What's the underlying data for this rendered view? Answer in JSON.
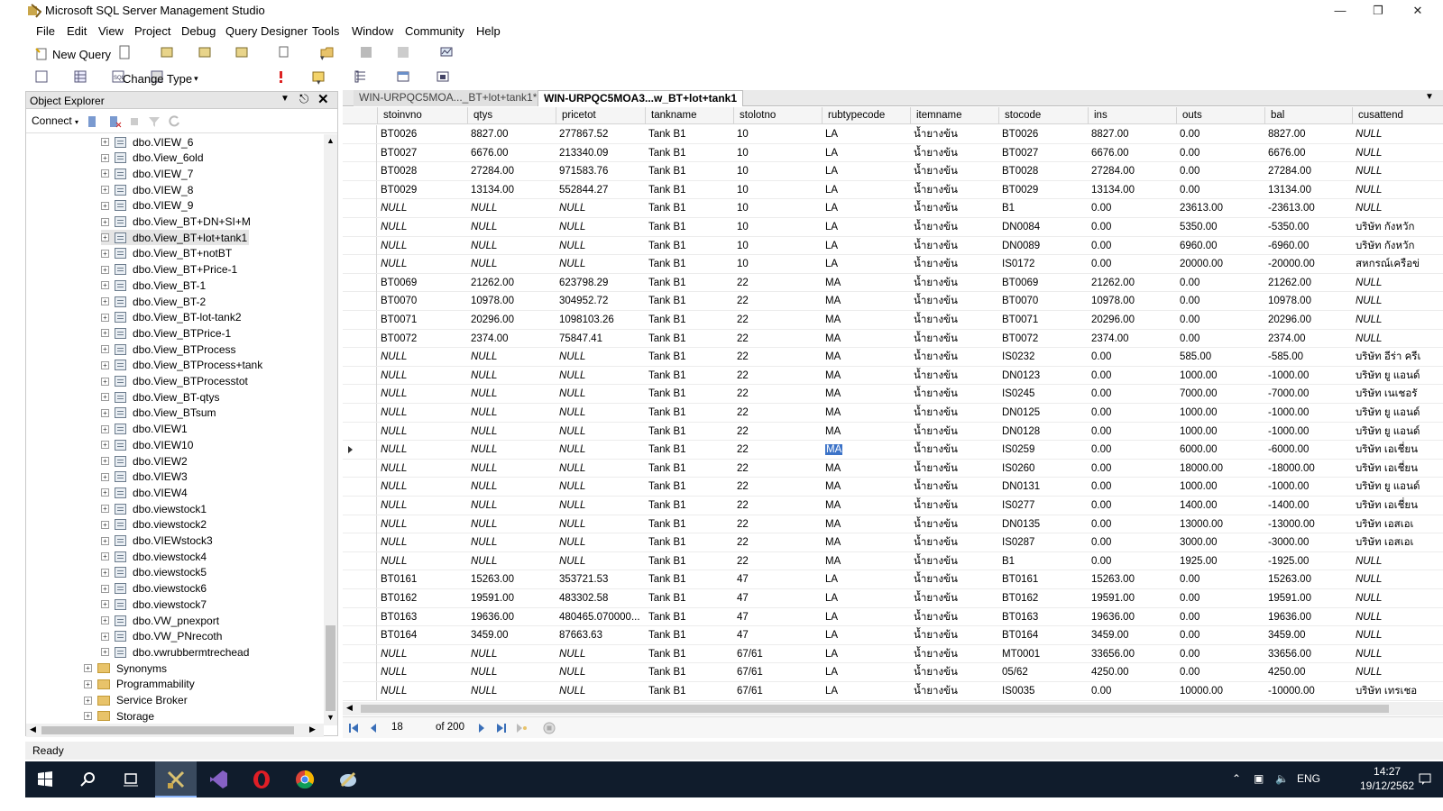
{
  "window": {
    "title": "Microsoft SQL Server Management Studio"
  },
  "menu": [
    "File",
    "Edit",
    "View",
    "Project",
    "Debug",
    "Query Designer",
    "Tools",
    "Window",
    "Community",
    "Help"
  ],
  "toolbar": {
    "new_query": "New Query",
    "change_type": "Change Type"
  },
  "object_explorer": {
    "title": "Object Explorer",
    "connect": "Connect",
    "items": [
      "dbo.VIEW_6",
      "dbo.View_6old",
      "dbo.VIEW_7",
      "dbo.VIEW_8",
      "dbo.VIEW_9",
      "dbo.View_BT+DN+SI+M",
      "dbo.View_BT+lot+tank1",
      "dbo.View_BT+notBT",
      "dbo.View_BT+Price-1",
      "dbo.View_BT-1",
      "dbo.View_BT-2",
      "dbo.View_BT-lot-tank2",
      "dbo.View_BTPrice-1",
      "dbo.View_BTProcess",
      "dbo.View_BTProcess+tank",
      "dbo.View_BTProcesstot",
      "dbo.View_BT-qtys",
      "dbo.View_BTsum",
      "dbo.VIEW1",
      "dbo.VIEW10",
      "dbo.VIEW2",
      "dbo.VIEW3",
      "dbo.VIEW4",
      "dbo.viewstock1",
      "dbo.viewstock2",
      "dbo.VIEWstock3",
      "dbo.viewstock4",
      "dbo.viewstock5",
      "dbo.viewstock6",
      "dbo.viewstock7",
      "dbo.VW_pnexport",
      "dbo.VW_PNrecoth",
      "dbo.vwrubbermtrechead"
    ],
    "folders": [
      "Synonyms",
      "Programmability",
      "Service Broker",
      "Storage"
    ]
  },
  "tabs": [
    "WIN-URPQC5MOA..._BT+lot+tank1*",
    "WIN-URPQC5MOA3...w_BT+lot+tank1"
  ],
  "grid": {
    "columns": [
      "stoinvno",
      "qtys",
      "pricetot",
      "tankname",
      "stolotno",
      "rubtypecode",
      "itemname",
      "stocode",
      "ins",
      "outs",
      "bal",
      "cusattend"
    ],
    "rows": [
      [
        "BT0026",
        "8827.00",
        "277867.52",
        "Tank B1",
        "10",
        "LA",
        "น้ำยางข้น",
        "BT0026",
        "8827.00",
        "0.00",
        "8827.00",
        "NULL"
      ],
      [
        "BT0027",
        "6676.00",
        "213340.09",
        "Tank B1",
        "10",
        "LA",
        "น้ำยางข้น",
        "BT0027",
        "6676.00",
        "0.00",
        "6676.00",
        "NULL"
      ],
      [
        "BT0028",
        "27284.00",
        "971583.76",
        "Tank B1",
        "10",
        "LA",
        "น้ำยางข้น",
        "BT0028",
        "27284.00",
        "0.00",
        "27284.00",
        "NULL"
      ],
      [
        "BT0029",
        "13134.00",
        "552844.27",
        "Tank B1",
        "10",
        "LA",
        "น้ำยางข้น",
        "BT0029",
        "13134.00",
        "0.00",
        "13134.00",
        "NULL"
      ],
      [
        "NULL",
        "NULL",
        "NULL",
        "Tank B1",
        "10",
        "LA",
        "น้ำยางข้น",
        "B1",
        "0.00",
        "23613.00",
        "-23613.00",
        "NULL"
      ],
      [
        "NULL",
        "NULL",
        "NULL",
        "Tank B1",
        "10",
        "LA",
        "น้ำยางข้น",
        "DN0084",
        "0.00",
        "5350.00",
        "-5350.00",
        "บริษัท กังหวัก"
      ],
      [
        "NULL",
        "NULL",
        "NULL",
        "Tank B1",
        "10",
        "LA",
        "น้ำยางข้น",
        "DN0089",
        "0.00",
        "6960.00",
        "-6960.00",
        "บริษัท กังหวัก"
      ],
      [
        "NULL",
        "NULL",
        "NULL",
        "Tank B1",
        "10",
        "LA",
        "น้ำยางข้น",
        "IS0172",
        "0.00",
        "20000.00",
        "-20000.00",
        "สหกรณ์เครือข่"
      ],
      [
        "BT0069",
        "21262.00",
        "623798.29",
        "Tank B1",
        "22",
        "MA",
        "น้ำยางข้น",
        "BT0069",
        "21262.00",
        "0.00",
        "21262.00",
        "NULL"
      ],
      [
        "BT0070",
        "10978.00",
        "304952.72",
        "Tank B1",
        "22",
        "MA",
        "น้ำยางข้น",
        "BT0070",
        "10978.00",
        "0.00",
        "10978.00",
        "NULL"
      ],
      [
        "BT0071",
        "20296.00",
        "1098103.26",
        "Tank B1",
        "22",
        "MA",
        "น้ำยางข้น",
        "BT0071",
        "20296.00",
        "0.00",
        "20296.00",
        "NULL"
      ],
      [
        "BT0072",
        "2374.00",
        "75847.41",
        "Tank B1",
        "22",
        "MA",
        "น้ำยางข้น",
        "BT0072",
        "2374.00",
        "0.00",
        "2374.00",
        "NULL"
      ],
      [
        "NULL",
        "NULL",
        "NULL",
        "Tank B1",
        "22",
        "MA",
        "น้ำยางข้น",
        "IS0232",
        "0.00",
        "585.00",
        "-585.00",
        "บริษัท อีร่า ครีเ"
      ],
      [
        "NULL",
        "NULL",
        "NULL",
        "Tank B1",
        "22",
        "MA",
        "น้ำยางข้น",
        "DN0123",
        "0.00",
        "1000.00",
        "-1000.00",
        "บริษัท ยู แอนด์"
      ],
      [
        "NULL",
        "NULL",
        "NULL",
        "Tank B1",
        "22",
        "MA",
        "น้ำยางข้น",
        "IS0245",
        "0.00",
        "7000.00",
        "-7000.00",
        "บริษัท เนเชอรั"
      ],
      [
        "NULL",
        "NULL",
        "NULL",
        "Tank B1",
        "22",
        "MA",
        "น้ำยางข้น",
        "DN0125",
        "0.00",
        "1000.00",
        "-1000.00",
        "บริษัท ยู แอนด์"
      ],
      [
        "NULL",
        "NULL",
        "NULL",
        "Tank B1",
        "22",
        "MA",
        "น้ำยางข้น",
        "DN0128",
        "0.00",
        "1000.00",
        "-1000.00",
        "บริษัท ยู แอนด์"
      ],
      [
        "NULL",
        "NULL",
        "NULL",
        "Tank B1",
        "22",
        "MA",
        "น้ำยางข้น",
        "IS0259",
        "0.00",
        "6000.00",
        "-6000.00",
        "บริษัท เอเชี่ยน"
      ],
      [
        "NULL",
        "NULL",
        "NULL",
        "Tank B1",
        "22",
        "MA",
        "น้ำยางข้น",
        "IS0260",
        "0.00",
        "18000.00",
        "-18000.00",
        "บริษัท เอเชี่ยน"
      ],
      [
        "NULL",
        "NULL",
        "NULL",
        "Tank B1",
        "22",
        "MA",
        "น้ำยางข้น",
        "DN0131",
        "0.00",
        "1000.00",
        "-1000.00",
        "บริษัท ยู แอนด์"
      ],
      [
        "NULL",
        "NULL",
        "NULL",
        "Tank B1",
        "22",
        "MA",
        "น้ำยางข้น",
        "IS0277",
        "0.00",
        "1400.00",
        "-1400.00",
        "บริษัท เอเชี่ยน"
      ],
      [
        "NULL",
        "NULL",
        "NULL",
        "Tank B1",
        "22",
        "MA",
        "น้ำยางข้น",
        "DN0135",
        "0.00",
        "13000.00",
        "-13000.00",
        "บริษัท เอสเอเ"
      ],
      [
        "NULL",
        "NULL",
        "NULL",
        "Tank B1",
        "22",
        "MA",
        "น้ำยางข้น",
        "IS0287",
        "0.00",
        "3000.00",
        "-3000.00",
        "บริษัท เอสเอเ"
      ],
      [
        "NULL",
        "NULL",
        "NULL",
        "Tank B1",
        "22",
        "MA",
        "น้ำยางข้น",
        "B1",
        "0.00",
        "1925.00",
        "-1925.00",
        "NULL"
      ],
      [
        "BT0161",
        "15263.00",
        "353721.53",
        "Tank B1",
        "47",
        "LA",
        "น้ำยางข้น",
        "BT0161",
        "15263.00",
        "0.00",
        "15263.00",
        "NULL"
      ],
      [
        "BT0162",
        "19591.00",
        "483302.58",
        "Tank B1",
        "47",
        "LA",
        "น้ำยางข้น",
        "BT0162",
        "19591.00",
        "0.00",
        "19591.00",
        "NULL"
      ],
      [
        "BT0163",
        "19636.00",
        "480465.070000...",
        "Tank B1",
        "47",
        "LA",
        "น้ำยางข้น",
        "BT0163",
        "19636.00",
        "0.00",
        "19636.00",
        "NULL"
      ],
      [
        "BT0164",
        "3459.00",
        "87663.63",
        "Tank B1",
        "47",
        "LA",
        "น้ำยางข้น",
        "BT0164",
        "3459.00",
        "0.00",
        "3459.00",
        "NULL"
      ],
      [
        "NULL",
        "NULL",
        "NULL",
        "Tank B1",
        "67/61",
        "LA",
        "น้ำยางข้น",
        "MT0001",
        "33656.00",
        "0.00",
        "33656.00",
        "NULL"
      ],
      [
        "NULL",
        "NULL",
        "NULL",
        "Tank B1",
        "67/61",
        "LA",
        "น้ำยางข้น",
        "05/62",
        "4250.00",
        "0.00",
        "4250.00",
        "NULL"
      ],
      [
        "NULL",
        "NULL",
        "NULL",
        "Tank B1",
        "67/61",
        "LA",
        "น้ำยางข้น",
        "IS0035",
        "0.00",
        "10000.00",
        "-10000.00",
        "บริษัท เทรเชอ"
      ]
    ]
  },
  "navigator": {
    "current": "18",
    "total": "of 200"
  },
  "status": "Ready",
  "taskbar": {
    "lang": "ENG",
    "time": "14:27",
    "date": "19/12/2562"
  }
}
